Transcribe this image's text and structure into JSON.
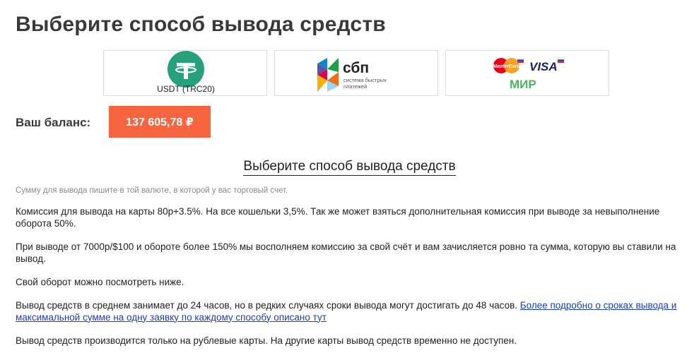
{
  "page": {
    "title": "Выберите способ вывода средств"
  },
  "methods": [
    {
      "name": "USDT (TRC20)",
      "icon": "tether-icon"
    },
    {
      "name": "сбп",
      "subtitle_line1": "система быстрых",
      "subtitle_line2": "платежей",
      "icon": "sbp-logo"
    },
    {
      "icons": [
        "mastercard-logo",
        "visa-logo",
        "mir-logo"
      ],
      "mastercard_text": "MasterCard",
      "visa_text": "VISA",
      "mir_text": "МИР"
    }
  ],
  "balance": {
    "label": "Ваш баланс:",
    "value": "137 605,78 ₽"
  },
  "section": {
    "title": "Выберите способ вывода средств",
    "hint": "Сумму для вывода пишите в той валюте, в которой у вас торговый счет."
  },
  "info": {
    "p1": "Комиссия для вывода на карты 80р+3.5%. На все кошельки 3,5%. Так же может взяться дополнительная комиссия при выводе за невыполнение оборота 50%.",
    "p2": "При выводе от 7000р/$100 и обороте более 150% мы восполняем комиссию за свой счёт и вам зачисляется ровно та сумма, которую вы ставили на вывод.",
    "p3": "Свой оборот можно посмотреть ниже.",
    "p4_text": "Вывод средств в среднем занимает до 24 часов, но в редких случаях сроки вывода могут достигать до 48 часов. ",
    "p4_link": "Более подробно о сроках вывода и максимальной сумме на одну заявку по каждому способу описано тут",
    "p5": "Вывод средств производится только на рублевые карты. На другие карты вывод средств временно не доступен."
  },
  "colors": {
    "accent": "#f6653f",
    "tether": "#26a17b",
    "link": "#1a3fc0"
  }
}
